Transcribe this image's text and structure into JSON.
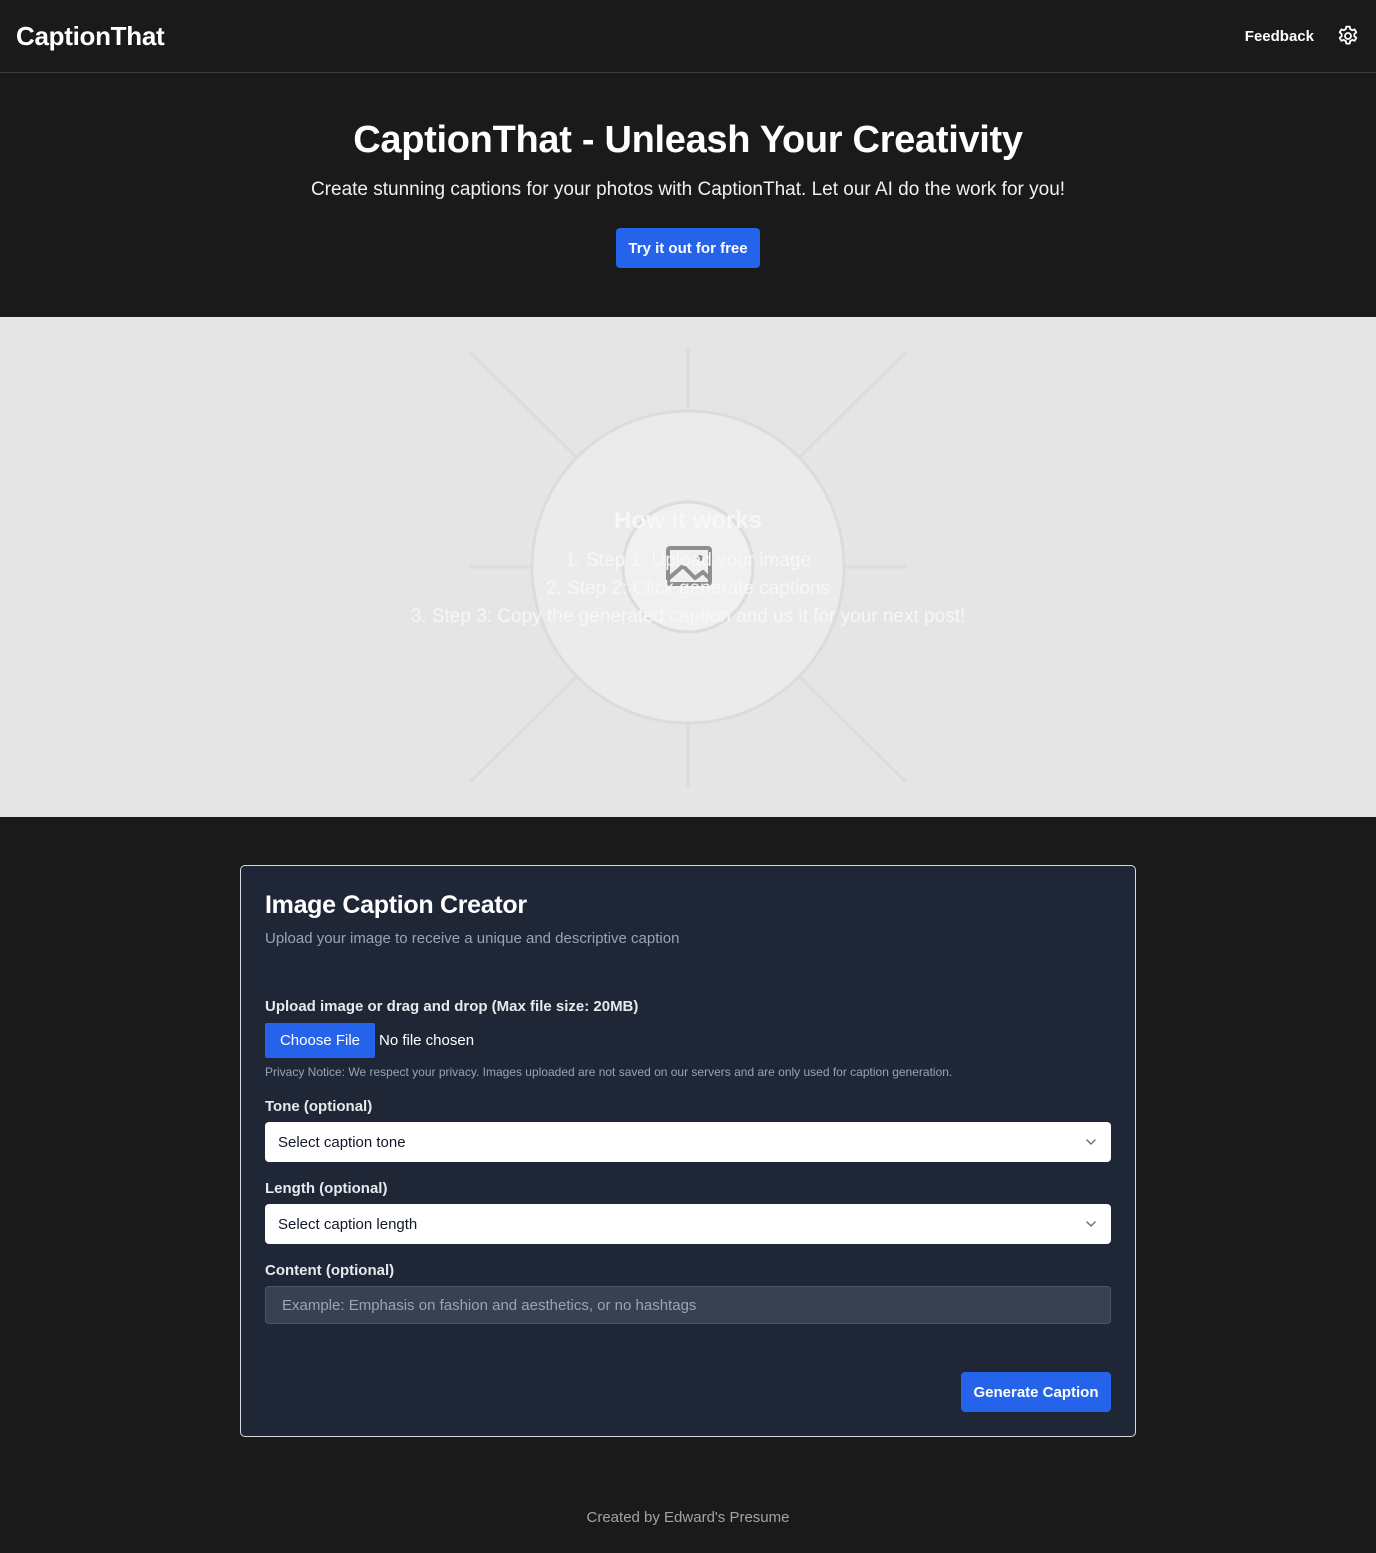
{
  "header": {
    "brand": "CaptionThat",
    "feedback_label": "Feedback",
    "settings_icon": "gear-icon"
  },
  "hero": {
    "title": "CaptionThat - Unleash Your Creativity",
    "subtitle": "Create stunning captions for your photos with CaptionThat. Let our AI do the work for you!",
    "cta_label": "Try it out for free"
  },
  "how_it_works": {
    "title": "How it works",
    "image_placeholder_icon": "image-placeholder-icon",
    "steps": [
      "1. Step 1: Upload your image",
      "2. Step 2: Click generate captions",
      "3. Step 3: Copy the generated caption and us it for your next post!"
    ]
  },
  "card": {
    "title": "Image Caption Creator",
    "subtitle": "Upload your image to receive a unique and descriptive caption",
    "upload_label": "Upload image or drag and drop (Max file size: 20MB)",
    "file_button_label": "Choose File",
    "file_status": "No file chosen",
    "privacy_notice": "Privacy Notice: We respect your privacy. Images uploaded are not saved on our servers and are only used for caption generation.",
    "tone_label": "Tone (optional)",
    "tone_value": "Select caption tone",
    "length_label": "Length (optional)",
    "length_value": "Select caption length",
    "content_label": "Content (optional)",
    "content_placeholder": "Example: Emphasis on fashion and aesthetics, or no hashtags",
    "content_value": "",
    "generate_label": "Generate Caption"
  },
  "footer": {
    "text": "Created by Edward's Presume"
  },
  "colors": {
    "background": "#1a1a1a",
    "accent": "#2563eb",
    "card_background": "#1f2737",
    "band_background": "#e5e5e5"
  }
}
